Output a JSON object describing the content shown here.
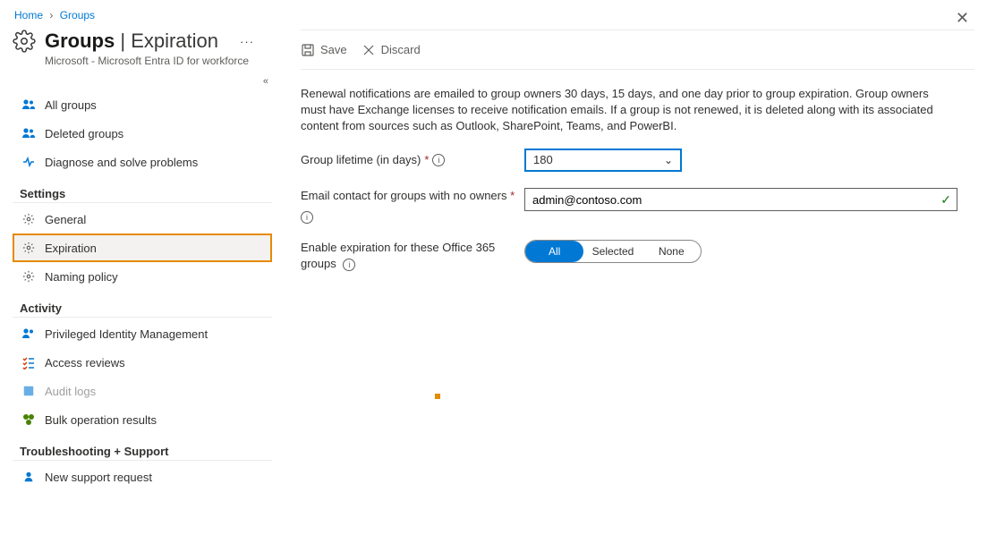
{
  "breadcrumb": {
    "home": "Home",
    "groups": "Groups"
  },
  "header": {
    "title_left": "Groups",
    "title_sep": " | ",
    "title_right": "Expiration",
    "subtitle": "Microsoft - Microsoft Entra ID for workforce"
  },
  "sidebar": {
    "items_top": [
      {
        "label": "All groups"
      },
      {
        "label": "Deleted groups"
      },
      {
        "label": "Diagnose and solve problems"
      }
    ],
    "section_settings": "Settings",
    "items_settings": [
      {
        "label": "General"
      },
      {
        "label": "Expiration",
        "selected": true
      },
      {
        "label": "Naming policy"
      }
    ],
    "section_activity": "Activity",
    "items_activity": [
      {
        "label": "Privileged Identity Management"
      },
      {
        "label": "Access reviews"
      },
      {
        "label": "Audit logs",
        "disabled": true
      },
      {
        "label": "Bulk operation results"
      }
    ],
    "section_support": "Troubleshooting + Support",
    "items_support": [
      {
        "label": "New support request"
      }
    ]
  },
  "toolbar": {
    "save": "Save",
    "discard": "Discard"
  },
  "content": {
    "description": "Renewal notifications are emailed to group owners 30 days, 15 days, and one day prior to group expiration. Group owners must have Exchange licenses to receive notification emails. If a group is not renewed, it is deleted along with its associated content from sources such as Outlook, SharePoint, Teams, and PowerBI.",
    "lifetime_label": "Group lifetime (in days)",
    "lifetime_value": "180",
    "email_label": "Email contact for groups with no owners",
    "email_value": "admin@contoso.com",
    "enable_label": "Enable expiration for these Office 365 groups",
    "pill_all": "All",
    "pill_selected": "Selected",
    "pill_none": "None"
  }
}
